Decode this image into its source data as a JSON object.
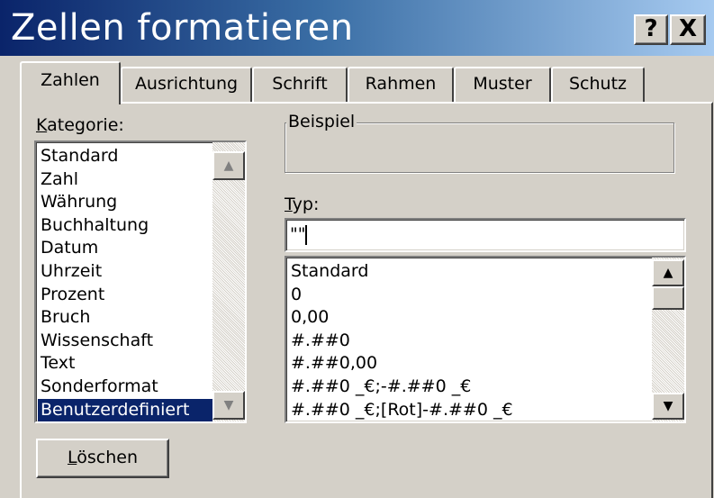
{
  "window": {
    "title": "Zellen formatieren",
    "help_button": "?",
    "close_button": "X"
  },
  "tabs": [
    {
      "label": "Zahlen",
      "active": true
    },
    {
      "label": "Ausrichtung",
      "active": false
    },
    {
      "label": "Schrift",
      "active": false
    },
    {
      "label": "Rahmen",
      "active": false
    },
    {
      "label": "Muster",
      "active": false
    },
    {
      "label": "Schutz",
      "active": false
    }
  ],
  "kategorie": {
    "label_mnemonic": "K",
    "label_rest": "ategorie:",
    "items": [
      "Standard",
      "Zahl",
      "Währung",
      "Buchhaltung",
      "Datum",
      "Uhrzeit",
      "Prozent",
      "Bruch",
      "Wissenschaft",
      "Text",
      "Sonderformat",
      "Benutzerdefiniert"
    ],
    "selected": "Benutzerdefiniert"
  },
  "beispiel": {
    "label": "Beispiel",
    "value": ""
  },
  "typ": {
    "label_mnemonic": "T",
    "label_rest": "yp:",
    "value": "\"\"",
    "items": [
      "Standard",
      "0",
      "0,00",
      "#.##0",
      "#.##0,00",
      "#.##0 _€;-#.##0 _€",
      "#.##0 _€;[Rot]-#.##0 _€"
    ]
  },
  "buttons": {
    "loeschen_mnemonic": "L",
    "loeschen_rest": "öschen"
  },
  "icons": {
    "scroll_up": "scroll-up-arrow-icon",
    "scroll_down": "scroll-down-arrow-icon"
  },
  "colors": {
    "title_gradient_start": "#0a246a",
    "title_gradient_end": "#a6caf0",
    "face": "#d4d0c8",
    "selection": "#0a246a"
  }
}
